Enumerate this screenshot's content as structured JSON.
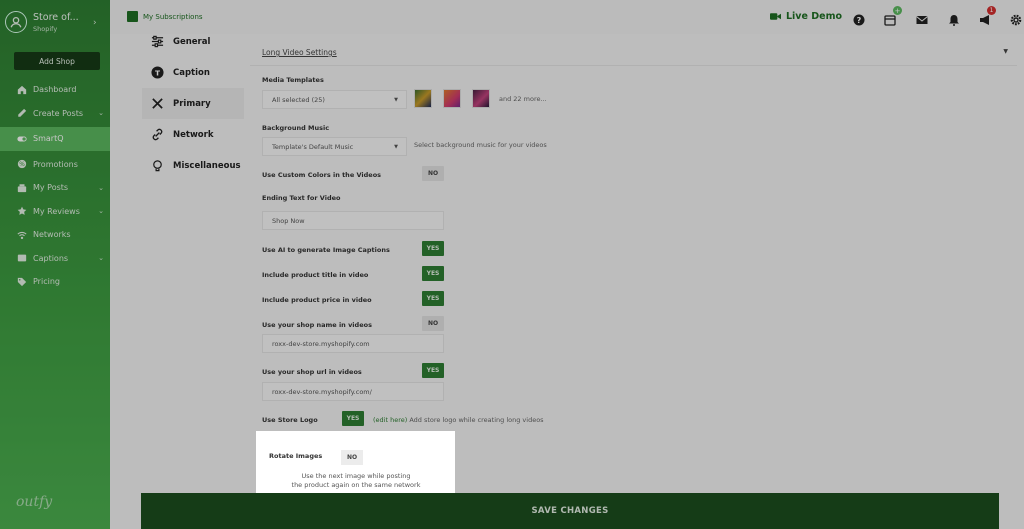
{
  "sidebar": {
    "store_name": "Store of...",
    "store_platform": "Shopify",
    "add_shop_label": "Add Shop",
    "brand": "outfy",
    "items": [
      {
        "label": "Dashboard",
        "icon": "home-icon",
        "active": false,
        "has_chevron": false
      },
      {
        "label": "Create Posts",
        "icon": "pencil-icon",
        "active": false,
        "has_chevron": true
      },
      {
        "label": "SmartQ",
        "icon": "toggle-icon",
        "active": true,
        "has_chevron": false
      },
      {
        "label": "Promotions",
        "icon": "promotion-icon",
        "active": false,
        "has_chevron": false
      },
      {
        "label": "My Posts",
        "icon": "posts-icon",
        "active": false,
        "has_chevron": true
      },
      {
        "label": "My Reviews",
        "icon": "star-icon",
        "active": false,
        "has_chevron": true
      },
      {
        "label": "Networks",
        "icon": "wifi-icon",
        "active": false,
        "has_chevron": false
      },
      {
        "label": "Captions",
        "icon": "captions-icon",
        "active": false,
        "has_chevron": true
      },
      {
        "label": "Pricing",
        "icon": "tag-icon",
        "active": false,
        "has_chevron": false
      }
    ]
  },
  "topbar": {
    "subscriptions_label": "My Subscriptions",
    "live_demo_label": "Live Demo",
    "notification_count": "1",
    "calendar_plus": "+"
  },
  "tabs": [
    {
      "label": "General",
      "icon": "sliders-icon",
      "active": false
    },
    {
      "label": "Caption",
      "icon": "caption-icon",
      "active": false
    },
    {
      "label": "Primary",
      "icon": "tools-icon",
      "active": true
    },
    {
      "label": "Network",
      "icon": "network-icon",
      "active": false
    },
    {
      "label": "Miscellaneous",
      "icon": "misc-icon",
      "active": false
    }
  ],
  "settings": {
    "section_title": "Long Video Settings",
    "media_templates_label": "Media Templates",
    "media_templates_value": "All selected (25)",
    "media_templates_more": "and 22 more...",
    "background_music_label": "Background Music",
    "background_music_value": "Template's Default Music",
    "background_music_hint": "Select background music for your videos",
    "custom_colors_label": "Use Custom Colors in the Videos",
    "custom_colors_value": "NO",
    "ending_text_label": "Ending Text for Video",
    "ending_text_value": "Shop Now",
    "ai_captions_label": "Use AI to generate Image Captions",
    "ai_captions_value": "YES",
    "product_title_label": "Include product title in video",
    "product_title_value": "YES",
    "product_price_label": "Include product price in video",
    "product_price_value": "YES",
    "shop_name_label": "Use your shop name in videos",
    "shop_name_value": "NO",
    "shop_name_field": "roxx-dev-store.myshopify.com",
    "shop_url_label": "Use your shop url in videos",
    "shop_url_value": "YES",
    "shop_url_field": "roxx-dev-store.myshopify.com/",
    "store_logo_label": "Use Store Logo",
    "store_logo_value": "YES",
    "store_logo_link": "(edit here)",
    "store_logo_hint": "Add store logo while creating long videos",
    "rotate_images_label": "Rotate Images",
    "rotate_images_value": "NO",
    "rotate_images_hint_1": "Use the next image while posting",
    "rotate_images_hint_2": "the product again on the same network"
  },
  "save_label": "SAVE CHANGES",
  "colors": {
    "sidebar_green": "#2e7d32",
    "active_green": "#5cb85f",
    "toggle_yes": "#2e7d32",
    "save_bar": "#1b4d1e",
    "badge_red": "#d32f2f"
  }
}
